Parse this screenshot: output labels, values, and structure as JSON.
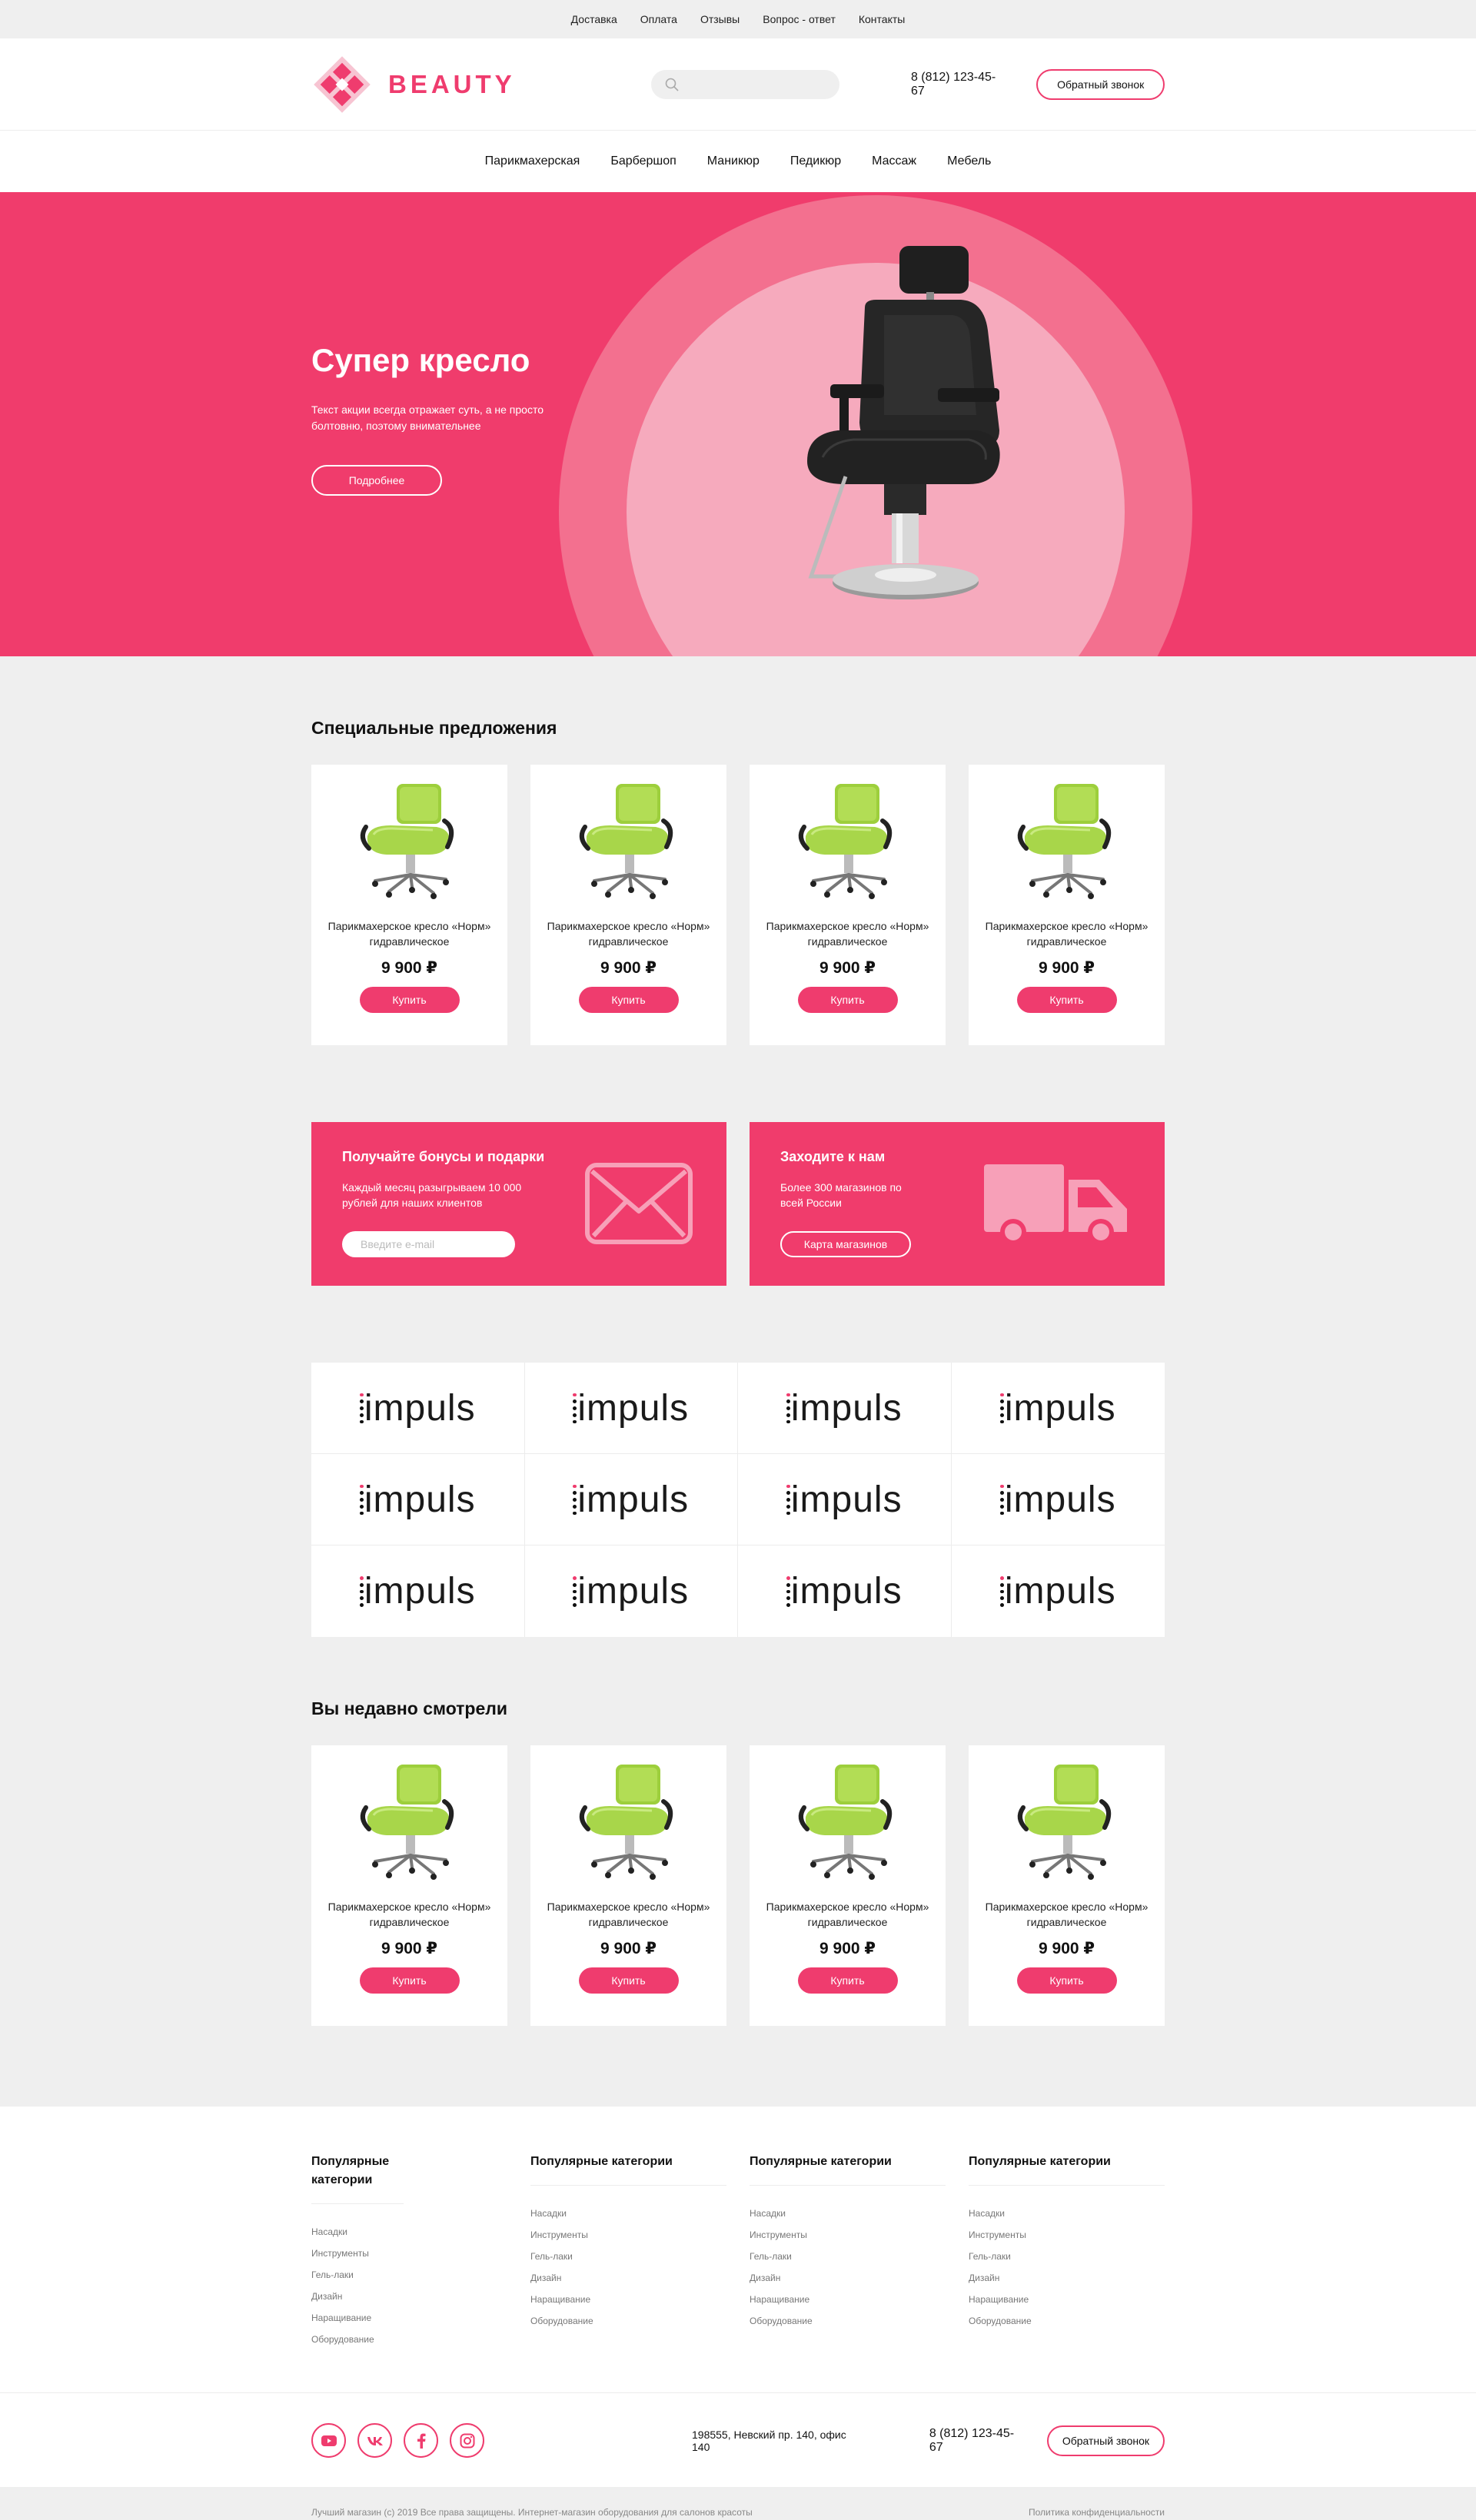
{
  "topbar": {
    "links": [
      "Доставка",
      "Оплата",
      "Отзывы",
      "Вопрос - ответ",
      "Контакты"
    ]
  },
  "header": {
    "logo_text": "BEAUTY",
    "search_placeholder": "",
    "phone": "8 (812) 123-45-67",
    "callback_label": "Обратный звонок"
  },
  "nav": {
    "items": [
      "Парикмахерская",
      "Барбершоп",
      "Маникюр",
      "Педикюр",
      "Массаж",
      "Мебель"
    ]
  },
  "hero": {
    "title": "Супер кресло",
    "description": "Текст акции всегда отражает суть, а не просто болтовню, поэтому внимательнее",
    "button_label": "Подробнее"
  },
  "specials": {
    "title": "Специальные предложения",
    "products": [
      {
        "name": "Парикмахерское кресло «Норм» гидравлическое",
        "price": "9 900 ₽",
        "button": "Купить"
      },
      {
        "name": "Парикмахерское кресло «Норм» гидравлическое",
        "price": "9 900 ₽",
        "button": "Купить"
      },
      {
        "name": "Парикмахерское кресло «Норм» гидравлическое",
        "price": "9 900 ₽",
        "button": "Купить"
      },
      {
        "name": "Парикмахерское кресло «Норм» гидравлическое",
        "price": "9 900 ₽",
        "button": "Купить"
      }
    ]
  },
  "promo_bonus": {
    "title": "Получайте бонусы и подарки",
    "text": "Каждый месяц разыгрываем 10 000 рублей для наших клиентов",
    "email_placeholder": "Введите e-mail"
  },
  "promo_stores": {
    "title": "Заходите к нам",
    "text": "Более 300 магазинов по всей России",
    "button_label": "Карта магазинов"
  },
  "brands": [
    "impuls",
    "impuls",
    "impuls",
    "impuls",
    "impuls",
    "impuls",
    "impuls",
    "impuls",
    "impuls",
    "impuls",
    "impuls",
    "impuls"
  ],
  "recent": {
    "title": "Вы недавно смотрели",
    "products": [
      {
        "name": "Парикмахерское кресло «Норм» гидравлическое",
        "price": "9 900 ₽",
        "button": "Купить"
      },
      {
        "name": "Парикмахерское кресло «Норм» гидравлическое",
        "price": "9 900 ₽",
        "button": "Купить"
      },
      {
        "name": "Парикмахерское кресло «Норм» гидравлическое",
        "price": "9 900 ₽",
        "button": "Купить"
      },
      {
        "name": "Парикмахерское кресло «Норм» гидравлическое",
        "price": "9 900 ₽",
        "button": "Купить"
      }
    ]
  },
  "footer": {
    "columns": [
      {
        "title": "Популярные категории",
        "links": [
          "Насадки",
          "Инструменты",
          "Гель-лаки",
          "Дизайн",
          "Наращивание",
          "Оборудование"
        ]
      },
      {
        "title": "Популярные категории",
        "links": [
          "Насадки",
          "Инструменты",
          "Гель-лаки",
          "Дизайн",
          "Наращивание",
          "Оборудование"
        ]
      },
      {
        "title": "Популярные категории",
        "links": [
          "Насадки",
          "Инструменты",
          "Гель-лаки",
          "Дизайн",
          "Наращивание",
          "Оборудование"
        ]
      },
      {
        "title": "Популярные категории",
        "links": [
          "Насадки",
          "Инструменты",
          "Гель-лаки",
          "Дизайн",
          "Наращивание",
          "Оборудование"
        ]
      }
    ],
    "social": [
      "youtube-icon",
      "vk-icon",
      "facebook-icon",
      "instagram-icon"
    ],
    "address": "198555, Невский пр. 140, офис 140",
    "phone": "8 (812) 123-45-67",
    "callback_label": "Обратный звонок",
    "copyright": "Лучший магазин (с) 2019 Все права защищены. Интернет-магазин оборудования для салонов красоты",
    "privacy": "Политика конфиденциальности"
  },
  "colors": {
    "accent": "#ef3c6e",
    "hero_bg": "#f03c6c",
    "hero_ring": "#f3708f",
    "hero_circle": "#f6aabd",
    "page_bg": "#efefef"
  }
}
